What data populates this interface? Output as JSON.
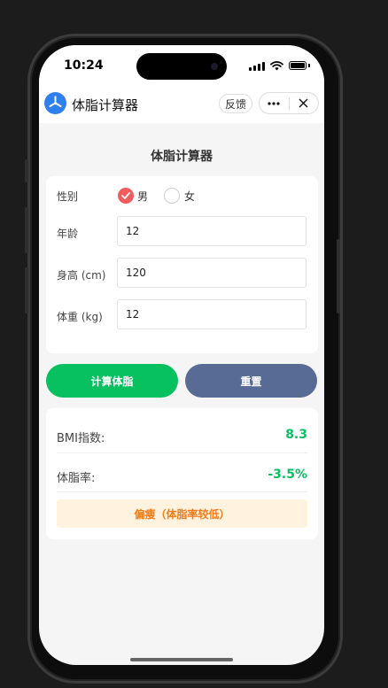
{
  "status_bar": {
    "time": "10:24"
  },
  "nav_bar": {
    "title": "体脂计算器",
    "feedback_label": "反馈",
    "more_icon": "more-dots-icon",
    "close_icon": "close-icon",
    "logo_icon": "app-logo-icon"
  },
  "page": {
    "heading": "体脂计算器"
  },
  "form": {
    "gender": {
      "label": "性别",
      "options": [
        {
          "label": "男",
          "checked": true
        },
        {
          "label": "女",
          "checked": false
        }
      ]
    },
    "age": {
      "label": "年龄",
      "value": "12"
    },
    "height": {
      "label": "身高 (cm)",
      "value": "120"
    },
    "weight": {
      "label": "体重 (kg)",
      "value": "12"
    }
  },
  "actions": {
    "calculate_label": "计算体脂",
    "reset_label": "重置"
  },
  "results": {
    "bmi_label": "BMI指数:",
    "bmi_value": "8.3",
    "bodyfat_label": "体脂率:",
    "bodyfat_value": "-3.5%",
    "status_text": "偏瘦（体脂率较低）"
  },
  "colors": {
    "primary_green": "#07c160",
    "reset_blue": "#576b95",
    "radio_checked": "#f25c5c",
    "status_orange": "#f07c1a",
    "status_bg": "#fff3e0"
  }
}
